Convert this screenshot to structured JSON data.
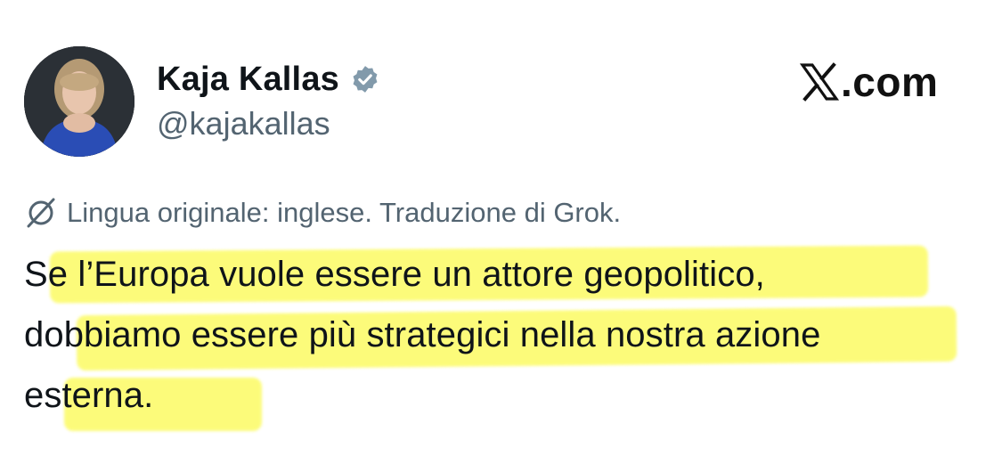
{
  "profile": {
    "name": "Kaja Kallas",
    "handle": "@kajakallas",
    "verified": true
  },
  "brand": {
    "text": ".com",
    "icon": "x-logo-icon"
  },
  "translation": {
    "icon": "grok-icon",
    "note": "Lingua originale: inglese. Traduzione di Grok."
  },
  "tweet": {
    "lines": [
      "Se l’Europa vuole essere un attore geopolitico,",
      "dobbiamo essere più strategici nella nostra azione",
      "esterna."
    ]
  },
  "colors": {
    "text_primary": "#0f1419",
    "text_secondary": "#536471",
    "verified_badge": "#829aab",
    "highlight": "#fcfb63"
  }
}
